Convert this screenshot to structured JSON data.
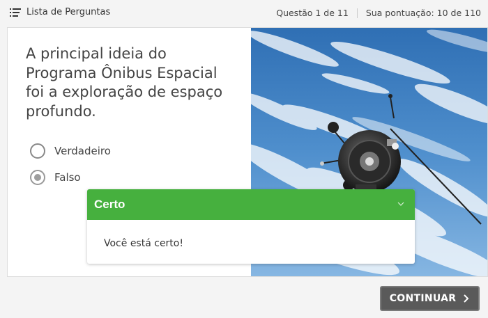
{
  "header": {
    "menu_label": "Lista de Perguntas",
    "question_counter": "Questão 1 de 11",
    "score": "Sua pontuação: 10 de 110"
  },
  "question": {
    "text": "A principal ideia do Programa Ônibus Espacial foi a exploração de espaço profundo.",
    "options": [
      {
        "label": "Verdadeiro",
        "selected": false
      },
      {
        "label": "Falso",
        "selected": true
      }
    ]
  },
  "image": {
    "subject": "satellite in orbit above clouds"
  },
  "feedback": {
    "title": "Certo",
    "message": "Você está certo!",
    "color": "#46b03e"
  },
  "footer": {
    "continue_label": "CONTINUAR"
  }
}
